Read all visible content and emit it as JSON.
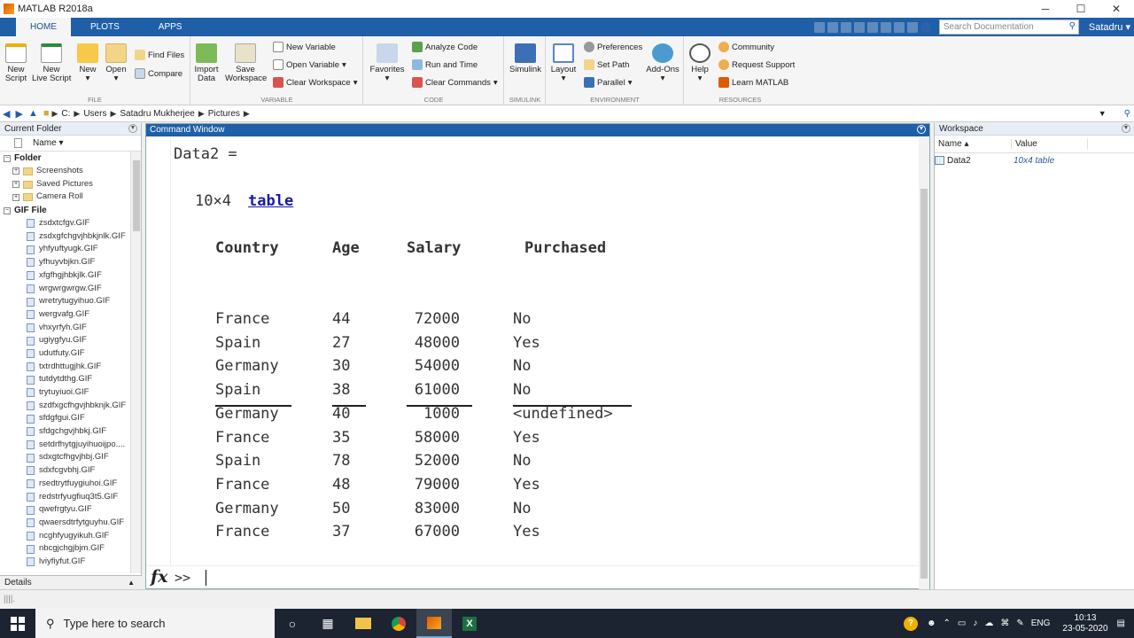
{
  "window": {
    "title": "MATLAB R2018a",
    "minimize": "─",
    "maximize": "☐",
    "close": "✕"
  },
  "ribbon_tabs": [
    "HOME",
    "PLOTS",
    "APPS"
  ],
  "search": {
    "placeholder": "Search Documentation"
  },
  "user": "Satadru ▾",
  "ribbon": {
    "file": {
      "label": "FILE",
      "new_script": "New\nScript",
      "new_live_script": "New\nLive Script",
      "new": "New",
      "open": "Open",
      "find_files": "Find Files",
      "compare": "Compare"
    },
    "variable": {
      "label": "VARIABLE",
      "import_data": "Import\nData",
      "save_workspace": "Save\nWorkspace",
      "new_variable": "New Variable",
      "open_variable": "Open Variable",
      "clear_workspace": "Clear Workspace"
    },
    "code": {
      "label": "CODE",
      "favorites": "Favorites",
      "analyze_code": "Analyze Code",
      "run_and_time": "Run and Time",
      "clear_commands": "Clear Commands"
    },
    "simulink": {
      "label": "SIMULINK",
      "simulink": "Simulink"
    },
    "environment": {
      "label": "ENVIRONMENT",
      "layout": "Layout",
      "preferences": "Preferences",
      "set_path": "Set Path",
      "parallel": "Parallel",
      "add_ons": "Add-Ons"
    },
    "resources": {
      "label": "RESOURCES",
      "help": "Help",
      "community": "Community",
      "request_support": "Request Support",
      "learn_matlab": "Learn MATLAB"
    }
  },
  "address": {
    "crumbs": [
      "C:",
      "Users",
      "Satadru Mukherjee",
      "Pictures"
    ]
  },
  "current_folder": {
    "title": "Current Folder",
    "col_name": "Name ▾",
    "folder_section": "Folder",
    "folders": [
      "Screenshots",
      "Saved Pictures",
      "Camera Roll"
    ],
    "gif_section": "GIF File",
    "files": [
      "zsdxtcfgv.GIF",
      "zsdxgfchgvjhbkjnlk.GIF",
      "yhfyuftyugk.GIF",
      "yfhuyvbjkn.GIF",
      "xfgfhgjhbkjlk.GIF",
      "wrgwrgwrgw.GIF",
      "wretrytugyihuo.GIF",
      "wergvafg.GIF",
      "vhxyrfyh.GIF",
      "ugiygfyu.GIF",
      "udutfuty.GIF",
      "txtrdhttugjhk.GIF",
      "tutdytdthg.GIF",
      "trytuyiuoi.GIF",
      "szdfxgcfhgvjhbknjk.GIF",
      "sfdgfgui.GIF",
      "sfdgchgvjhbkj.GIF",
      "setdrfhytgjuyihuoijpo....",
      "sdxgtcfhgvjhbj.GIF",
      "sdxfcgvbhj.GIF",
      "rsedtrytfuygiuhoi.GIF",
      "redstrfyugfiuq3t5.GIF",
      "qwefrgtyu.GIF",
      "qwaersdtrfytguyhu.GIF",
      "ncghfyugyikuh.GIF",
      "nbcgjchgjbjm.GIF",
      "lviyfiyfut.GIF"
    ],
    "details": "Details"
  },
  "command_window": {
    "title": "Command Window",
    "var_line": "Data2 =",
    "size_text": "10×4",
    "size_link": "table",
    "headers": [
      "Country",
      "Age",
      "Salary",
      "Purchased"
    ],
    "rows": [
      [
        "France",
        "44",
        "72000",
        "No"
      ],
      [
        "Spain",
        "27",
        "48000",
        "Yes"
      ],
      [
        "Germany",
        "30",
        "54000",
        "No"
      ],
      [
        "Spain",
        "38",
        "61000",
        "No"
      ],
      [
        "Germany",
        "40",
        "1000",
        "<undefined>"
      ],
      [
        "France",
        "35",
        "58000",
        "Yes"
      ],
      [
        "Spain",
        "78",
        "52000",
        "No"
      ],
      [
        "France",
        "48",
        "79000",
        "Yes"
      ],
      [
        "Germany",
        "50",
        "83000",
        "No"
      ],
      [
        "France",
        "37",
        "67000",
        "Yes"
      ]
    ],
    "fx": "fx",
    "prompt": ">>"
  },
  "workspace": {
    "title": "Workspace",
    "col_name": "Name ▴",
    "col_value": "Value",
    "var_name": "Data2",
    "var_value": "10x4 table"
  },
  "taskbar": {
    "search_placeholder": "Type here to search",
    "lang": "ENG",
    "time": "10:13",
    "date": "23-05-2020"
  }
}
